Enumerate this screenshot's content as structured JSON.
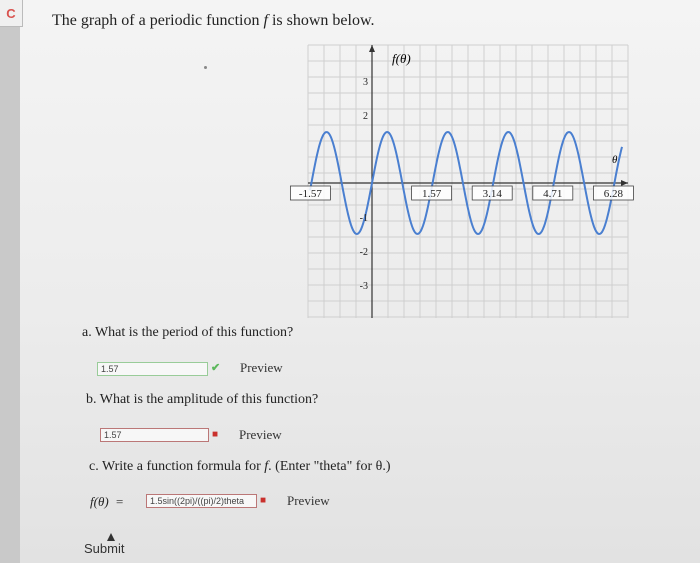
{
  "header": {
    "logo_letter": "C",
    "title_prefix": "The graph of a periodic function ",
    "title_var": "f",
    "title_suffix": " is shown below."
  },
  "graph": {
    "y_axis_label": "f(θ)",
    "x_axis_label": "θ",
    "x_tick_labels": [
      "-1.57",
      "1.57",
      "3.14",
      "4.71",
      "6.28"
    ],
    "y_tick_labels": [
      "3",
      "2",
      "-1",
      "-2",
      "-3"
    ],
    "function": "1.5*sin(4*theta)",
    "amplitude": 1.5,
    "period": 1.57,
    "x_range": [
      -1.57,
      6.8
    ],
    "y_range": [
      -3.5,
      3.5
    ],
    "grid": true
  },
  "questions": {
    "a": {
      "label": "a. What is the period of this function?",
      "answer": "1.57",
      "status": "correct",
      "preview": "Preview"
    },
    "b": {
      "label": "b. What is the amplitude of this function?",
      "answer": "1.57",
      "status": "incorrect",
      "preview": "Preview"
    },
    "c": {
      "label_prefix": "c. Write a function formula for ",
      "label_var": "f",
      "label_suffix": ". (Enter \"theta\" for θ.)",
      "lhs": "f(θ)  =",
      "answer": "1.5sin((2pi)/((pi)/2)theta",
      "status": "incorrect",
      "preview": "Preview"
    }
  },
  "submit_label": "Submit",
  "colors": {
    "curve": "#4a7fd0",
    "grid": "#cfcfcf",
    "correct": "#5cb85c",
    "incorrect": "#c9302c"
  }
}
